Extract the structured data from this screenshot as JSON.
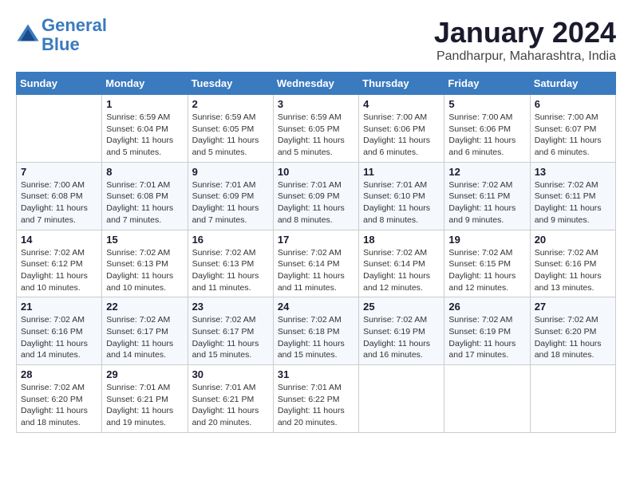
{
  "logo": {
    "line1": "General",
    "line2": "Blue"
  },
  "title": "January 2024",
  "subtitle": "Pandharpur, Maharashtra, India",
  "weekdays": [
    "Sunday",
    "Monday",
    "Tuesday",
    "Wednesday",
    "Thursday",
    "Friday",
    "Saturday"
  ],
  "weeks": [
    [
      {
        "day": "",
        "sunrise": "",
        "sunset": "",
        "daylight": ""
      },
      {
        "day": "1",
        "sunrise": "Sunrise: 6:59 AM",
        "sunset": "Sunset: 6:04 PM",
        "daylight": "Daylight: 11 hours and 5 minutes."
      },
      {
        "day": "2",
        "sunrise": "Sunrise: 6:59 AM",
        "sunset": "Sunset: 6:05 PM",
        "daylight": "Daylight: 11 hours and 5 minutes."
      },
      {
        "day": "3",
        "sunrise": "Sunrise: 6:59 AM",
        "sunset": "Sunset: 6:05 PM",
        "daylight": "Daylight: 11 hours and 5 minutes."
      },
      {
        "day": "4",
        "sunrise": "Sunrise: 7:00 AM",
        "sunset": "Sunset: 6:06 PM",
        "daylight": "Daylight: 11 hours and 6 minutes."
      },
      {
        "day": "5",
        "sunrise": "Sunrise: 7:00 AM",
        "sunset": "Sunset: 6:06 PM",
        "daylight": "Daylight: 11 hours and 6 minutes."
      },
      {
        "day": "6",
        "sunrise": "Sunrise: 7:00 AM",
        "sunset": "Sunset: 6:07 PM",
        "daylight": "Daylight: 11 hours and 6 minutes."
      }
    ],
    [
      {
        "day": "7",
        "sunrise": "",
        "sunset": "",
        "daylight": "Daylight: 11 hours and 7 minutes."
      },
      {
        "day": "8",
        "sunrise": "Sunrise: 7:01 AM",
        "sunset": "Sunset: 6:08 PM",
        "daylight": "Daylight: 11 hours and 7 minutes."
      },
      {
        "day": "9",
        "sunrise": "Sunrise: 7:01 AM",
        "sunset": "Sunset: 6:09 PM",
        "daylight": "Daylight: 11 hours and 7 minutes."
      },
      {
        "day": "10",
        "sunrise": "Sunrise: 7:01 AM",
        "sunset": "Sunset: 6:09 PM",
        "daylight": "Daylight: 11 hours and 8 minutes."
      },
      {
        "day": "11",
        "sunrise": "Sunrise: 7:01 AM",
        "sunset": "Sunset: 6:10 PM",
        "daylight": "Daylight: 11 hours and 8 minutes."
      },
      {
        "day": "12",
        "sunrise": "Sunrise: 7:02 AM",
        "sunset": "Sunset: 6:11 PM",
        "daylight": "Daylight: 11 hours and 9 minutes."
      },
      {
        "day": "13",
        "sunrise": "Sunrise: 7:02 AM",
        "sunset": "Sunset: 6:11 PM",
        "daylight": "Daylight: 11 hours and 9 minutes."
      }
    ],
    [
      {
        "day": "14",
        "sunrise": "",
        "sunset": "",
        "daylight": "Daylight: 11 hours and 10 minutes."
      },
      {
        "day": "15",
        "sunrise": "Sunrise: 7:02 AM",
        "sunset": "Sunset: 6:13 PM",
        "daylight": "Daylight: 11 hours and 10 minutes."
      },
      {
        "day": "16",
        "sunrise": "Sunrise: 7:02 AM",
        "sunset": "Sunset: 6:13 PM",
        "daylight": "Daylight: 11 hours and 11 minutes."
      },
      {
        "day": "17",
        "sunrise": "Sunrise: 7:02 AM",
        "sunset": "Sunset: 6:14 PM",
        "daylight": "Daylight: 11 hours and 11 minutes."
      },
      {
        "day": "18",
        "sunrise": "Sunrise: 7:02 AM",
        "sunset": "Sunset: 6:14 PM",
        "daylight": "Daylight: 11 hours and 12 minutes."
      },
      {
        "day": "19",
        "sunrise": "Sunrise: 7:02 AM",
        "sunset": "Sunset: 6:15 PM",
        "daylight": "Daylight: 11 hours and 12 minutes."
      },
      {
        "day": "20",
        "sunrise": "Sunrise: 7:02 AM",
        "sunset": "Sunset: 6:16 PM",
        "daylight": "Daylight: 11 hours and 13 minutes."
      }
    ],
    [
      {
        "day": "21",
        "sunrise": "",
        "sunset": "",
        "daylight": "Daylight: 11 hours and 14 minutes."
      },
      {
        "day": "22",
        "sunrise": "Sunrise: 7:02 AM",
        "sunset": "Sunset: 6:17 PM",
        "daylight": "Daylight: 11 hours and 14 minutes."
      },
      {
        "day": "23",
        "sunrise": "Sunrise: 7:02 AM",
        "sunset": "Sunset: 6:17 PM",
        "daylight": "Daylight: 11 hours and 15 minutes."
      },
      {
        "day": "24",
        "sunrise": "Sunrise: 7:02 AM",
        "sunset": "Sunset: 6:18 PM",
        "daylight": "Daylight: 11 hours and 15 minutes."
      },
      {
        "day": "25",
        "sunrise": "Sunrise: 7:02 AM",
        "sunset": "Sunset: 6:19 PM",
        "daylight": "Daylight: 11 hours and 16 minutes."
      },
      {
        "day": "26",
        "sunrise": "Sunrise: 7:02 AM",
        "sunset": "Sunset: 6:19 PM",
        "daylight": "Daylight: 11 hours and 17 minutes."
      },
      {
        "day": "27",
        "sunrise": "Sunrise: 7:02 AM",
        "sunset": "Sunset: 6:20 PM",
        "daylight": "Daylight: 11 hours and 18 minutes."
      }
    ],
    [
      {
        "day": "28",
        "sunrise": "Sunrise: 7:02 AM",
        "sunset": "Sunset: 6:20 PM",
        "daylight": "Daylight: 11 hours and 18 minutes."
      },
      {
        "day": "29",
        "sunrise": "Sunrise: 7:01 AM",
        "sunset": "Sunset: 6:21 PM",
        "daylight": "Daylight: 11 hours and 19 minutes."
      },
      {
        "day": "30",
        "sunrise": "Sunrise: 7:01 AM",
        "sunset": "Sunset: 6:21 PM",
        "daylight": "Daylight: 11 hours and 20 minutes."
      },
      {
        "day": "31",
        "sunrise": "Sunrise: 7:01 AM",
        "sunset": "Sunset: 6:22 PM",
        "daylight": "Daylight: 11 hours and 20 minutes."
      },
      {
        "day": "",
        "sunrise": "",
        "sunset": "",
        "daylight": ""
      },
      {
        "day": "",
        "sunrise": "",
        "sunset": "",
        "daylight": ""
      },
      {
        "day": "",
        "sunrise": "",
        "sunset": "",
        "daylight": ""
      }
    ]
  ],
  "week1_sun_detail": "Sunrise: 7:00 AM\nSunset: 6:08 PM\nDaylight: 11 hours and 7 minutes.",
  "week2_sun_detail": "Sunrise: 7:02 AM\nSunset: 6:12 PM\nDaylight: 11 hours and 10 minutes.",
  "week3_sun_detail": "Sunrise: 7:02 AM\nSunset: 6:16 PM\nDaylight: 11 hours and 14 minutes.",
  "week4_sun_detail": "Sunrise: 7:02 AM\nSunset: 6:20 PM\nDaylight: 11 hours and 18 minutes."
}
